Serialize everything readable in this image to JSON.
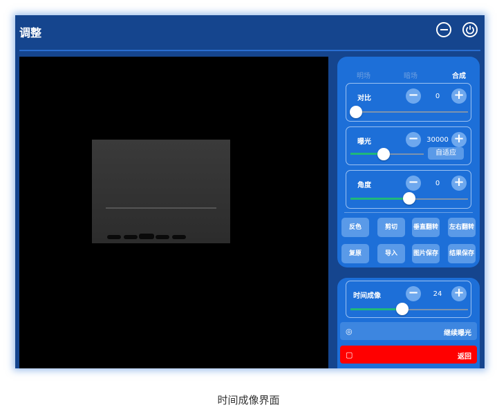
{
  "window": {
    "title": "调整"
  },
  "modes": {
    "items": [
      "明场",
      "暗场",
      "合成"
    ],
    "active": "合成"
  },
  "contrast": {
    "label": "对比",
    "value": "0",
    "level": 0.0
  },
  "exposure": {
    "label": "曝光",
    "value": "30000",
    "auto_label": "自适应",
    "level": 0.45
  },
  "angle": {
    "label": "角度",
    "value": "0",
    "level": 0.5
  },
  "buttons": {
    "invert": "反色",
    "crop": "剪切",
    "flip_v": "垂直翻转",
    "flip_h": "左右翻转",
    "reset": "复原",
    "import": "导入",
    "save_image": "图片保存",
    "save_result": "结果保存"
  },
  "timelapse": {
    "label": "时间成像",
    "value": "24",
    "level": 0.45
  },
  "continue": {
    "label": "继续曝光"
  },
  "back": {
    "label": "返回"
  },
  "caption": "时间成像界面",
  "colors": {
    "frame": "#15458e",
    "panel": "#1d6fd8",
    "accent": "#1fb87a",
    "danger": "#ff0000"
  }
}
